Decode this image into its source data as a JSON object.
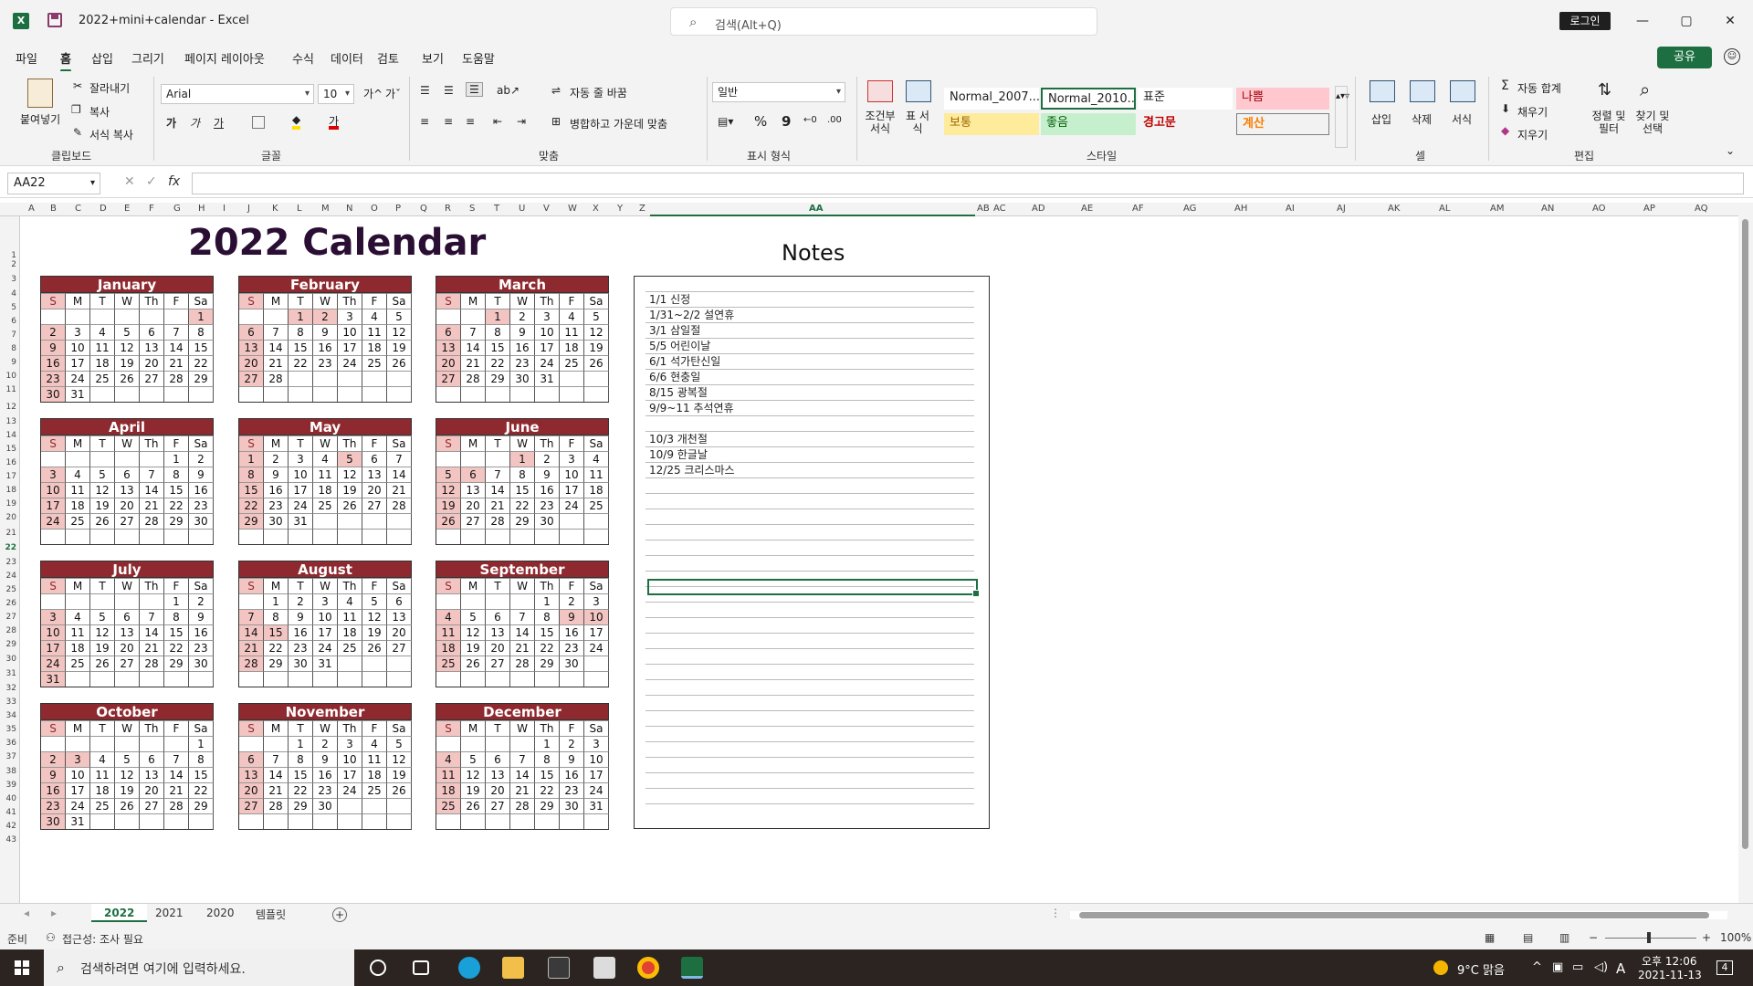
{
  "window": {
    "title": "2022+mini+calendar  -  Excel",
    "search_placeholder": "검색(Alt+Q)",
    "login_label": "로그인",
    "minimize": "—",
    "maximize": "▢",
    "close": "✕",
    "app_logo": "X"
  },
  "menu": [
    "파일",
    "홈",
    "삽입",
    "그리기",
    "페이지 레이아웃",
    "수식",
    "데이터",
    "검토",
    "보기",
    "도움말"
  ],
  "menu_active": "홈",
  "share_label": "공유",
  "ribbon": {
    "clipboard": {
      "paste": "붙여넣기",
      "cut": "잘라내기",
      "copy": "복사",
      "format_painter": "서식 복사",
      "group": "클립보드"
    },
    "font": {
      "name": "Arial",
      "size": "10",
      "group": "글꼴",
      "bold": "가",
      "italic": "가",
      "underline": "가",
      "grow": "가^",
      "shrink": "가ˇ"
    },
    "alignment": {
      "wrap": "자동 줄 바꿈",
      "merge": "병합하고 가운데 맞춤",
      "group": "맞춤"
    },
    "number": {
      "format": "일반",
      "percent": "%",
      "comma": "9",
      "group": "표시 형식"
    },
    "styles": {
      "cond": "조건부 서식",
      "table": "표 서식",
      "cells": [
        "Normal_2007...",
        "Normal_2010...",
        "표준",
        "나쁨",
        "보통",
        "좋음",
        "경고문",
        "계산"
      ],
      "group": "스타일"
    },
    "cells": {
      "insert": "삽입",
      "delete": "삭제",
      "format": "서식",
      "group": "셀"
    },
    "editing": {
      "autosum": "자동 합계",
      "fill": "채우기",
      "clear": "지우기",
      "sort": "정렬 및 필터",
      "find": "찾기 및 선택",
      "group": "편집"
    }
  },
  "namebox": "AA22",
  "fx_label": "fx",
  "columns": [
    "A",
    "B",
    "C",
    "D",
    "E",
    "F",
    "G",
    "H",
    "I",
    "J",
    "K",
    "L",
    "M",
    "N",
    "O",
    "P",
    "Q",
    "R",
    "S",
    "T",
    "U",
    "V",
    "W",
    "X",
    "Y",
    "Z",
    "AA",
    "AB",
    "AC",
    "AD",
    "AE",
    "AF",
    "AG",
    "AH",
    "AI",
    "AJ",
    "AK",
    "AL",
    "AM",
    "AN",
    "AO",
    "AP",
    "AQ"
  ],
  "rows": [
    "1",
    "2",
    "3",
    "4",
    "5",
    "6",
    "7",
    "8",
    "9",
    "10",
    "11",
    "12",
    "13",
    "14",
    "15",
    "16",
    "17",
    "18",
    "19",
    "20",
    "21",
    "22",
    "23",
    "24",
    "25",
    "26",
    "27",
    "28",
    "29",
    "30",
    "31",
    "32",
    "33",
    "34",
    "35",
    "36",
    "37",
    "38",
    "39",
    "40",
    "41",
    "42",
    "43"
  ],
  "calendar_title": "2022 Calendar",
  "dow": [
    "S",
    "M",
    "T",
    "W",
    "Th",
    "F",
    "Sa"
  ],
  "months": [
    {
      "name": "January",
      "start": 6,
      "days": 31,
      "holidays": [
        1
      ]
    },
    {
      "name": "February",
      "start": 2,
      "days": 28,
      "holidays": [
        1,
        2
      ]
    },
    {
      "name": "March",
      "start": 2,
      "days": 31,
      "holidays": [
        1
      ]
    },
    {
      "name": "April",
      "start": 5,
      "days": 30,
      "holidays": []
    },
    {
      "name": "May",
      "start": 0,
      "days": 31,
      "holidays": [
        5
      ]
    },
    {
      "name": "June",
      "start": 3,
      "days": 30,
      "holidays": [
        1,
        6
      ]
    },
    {
      "name": "July",
      "start": 5,
      "days": 31,
      "holidays": []
    },
    {
      "name": "August",
      "start": 1,
      "days": 31,
      "holidays": [
        15
      ]
    },
    {
      "name": "September",
      "start": 4,
      "days": 30,
      "holidays": [
        9,
        10
      ]
    },
    {
      "name": "October",
      "start": 6,
      "days": 31,
      "holidays": [
        3
      ]
    },
    {
      "name": "November",
      "start": 2,
      "days": 30,
      "holidays": []
    },
    {
      "name": "December",
      "start": 4,
      "days": 31,
      "holidays": []
    }
  ],
  "notes_title": "Notes",
  "notes": [
    "1/1 신정",
    "1/31~2/2 설연휴",
    "3/1 삼일절",
    "5/5 어린이날",
    "6/1 석가탄신일",
    "6/6 현충일",
    "8/15 광복절",
    "9/9~11 추석연휴",
    "",
    "10/3 개천절",
    "10/9 한글날",
    "12/25 크리스마스"
  ],
  "sheets": [
    "2022",
    "2021",
    "2020",
    "템플릿"
  ],
  "active_sheet": "2022",
  "status": {
    "ready": "준비",
    "accessibility": "접근성: 조사 필요",
    "zoom": "100%"
  },
  "taskbar": {
    "search_placeholder": "검색하려면 여기에 입력하세요.",
    "weather": "9°C  맑음",
    "time": "오후 12:06",
    "date": "2021-11-13",
    "ime": "A",
    "notif": "4"
  },
  "colors": {
    "excel_green": "#1d6f42",
    "month_header": "#8e2a2f",
    "holiday": "#f3c5c2",
    "title": "#2a0e33"
  }
}
